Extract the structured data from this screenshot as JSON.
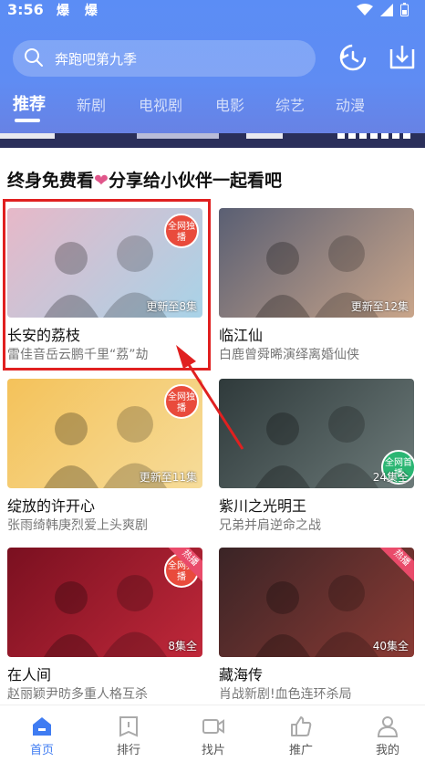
{
  "status": {
    "time": "3:56",
    "left_icons": "爆 爆"
  },
  "search": {
    "placeholder": "奔跑吧第九季"
  },
  "tabs": [
    {
      "label": "推荐",
      "active": true
    },
    {
      "label": "新剧"
    },
    {
      "label": "电视剧"
    },
    {
      "label": "电影"
    },
    {
      "label": "综艺"
    },
    {
      "label": "动漫"
    }
  ],
  "section": {
    "title_a": "终身免费看",
    "heart": "❤",
    "title_b": "分享给小伙伴一起看吧"
  },
  "cards": [
    {
      "title": "长安的荔枝",
      "subtitle": "雷佳音岳云鹏千里“荔”劫",
      "badge": "更新至8集",
      "stamp": "全网独播",
      "thumb_colors": [
        "#e7b8c8",
        "#a8d3e8"
      ]
    },
    {
      "title": "临江仙",
      "subtitle": "白鹿曾舜晞演绎离婚仙侠",
      "badge": "更新至12集",
      "stamp": "",
      "thumb_colors": [
        "#5a5f73",
        "#c9a58a"
      ]
    },
    {
      "title": "绽放的许开心",
      "subtitle": "张雨绮韩庚烈爱上头爽剧",
      "badge": "更新至11集",
      "stamp": "全网独播",
      "thumb_colors": [
        "#f4c25a",
        "#f6dc9a"
      ]
    },
    {
      "title": "紫川之光明王",
      "subtitle": "兄弟并肩逆命之战",
      "badge": "24集全",
      "stamp": "全网首播",
      "thumb_colors": [
        "#2f3a3b",
        "#6c7a79"
      ]
    },
    {
      "title": "在人间",
      "subtitle": "赵丽颖尹昉多重人格互杀",
      "badge": "8集全",
      "stamp": "全网独播",
      "hot": "热播",
      "thumb_colors": [
        "#7a1020",
        "#c0283a"
      ]
    },
    {
      "title": "藏海传",
      "subtitle": "肖战新剧!血色连环杀局",
      "badge": "40集全",
      "stamp": "",
      "hot": "热播",
      "thumb_colors": [
        "#3a2426",
        "#8a3a34"
      ]
    }
  ],
  "nav": [
    {
      "label": "首页",
      "icon": "home-icon",
      "active": true
    },
    {
      "label": "排行",
      "icon": "rank-icon"
    },
    {
      "label": "找片",
      "icon": "video-icon"
    },
    {
      "label": "推广",
      "icon": "thumb-up-icon"
    },
    {
      "label": "我的",
      "icon": "user-icon"
    }
  ],
  "colors": {
    "accent": "#3f7cf2",
    "header": "#5b8df5",
    "highlight": "#e02020"
  }
}
